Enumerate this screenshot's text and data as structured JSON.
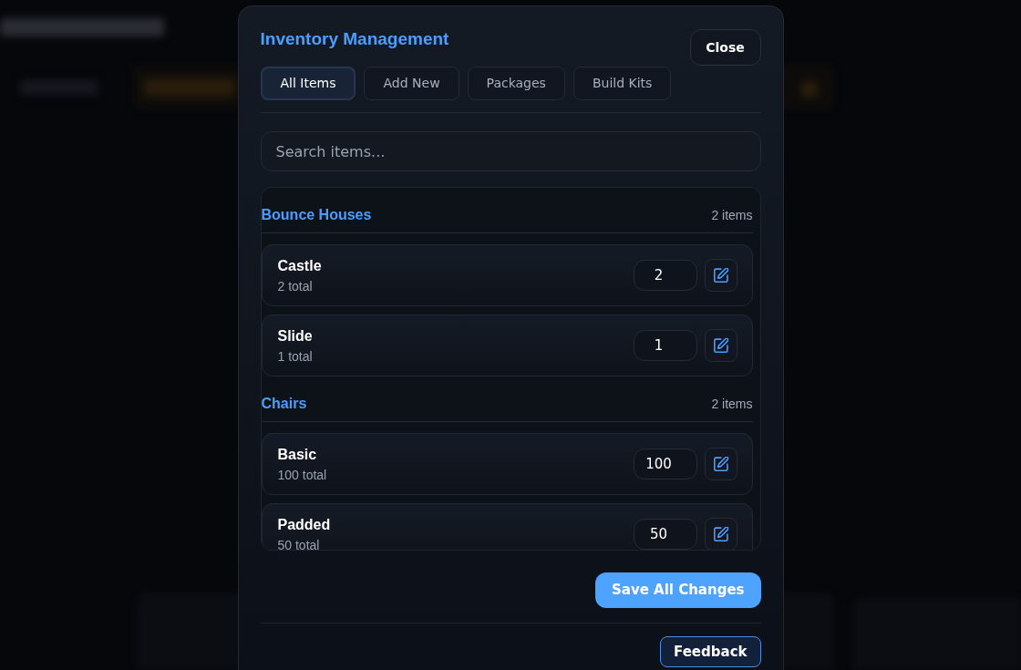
{
  "dialog": {
    "title": "Inventory Management",
    "close_button": "Close",
    "tabs": [
      {
        "label": "All Items",
        "selected": true
      },
      {
        "label": "Add New",
        "selected": false
      },
      {
        "label": "Packages",
        "selected": false
      },
      {
        "label": "Build Kits",
        "selected": false
      }
    ],
    "search": {
      "placeholder": "Search items..."
    },
    "categories": [
      {
        "name": "Bounce Houses",
        "count": "2 items",
        "items": [
          {
            "name": "Castle",
            "total": "2 total",
            "quantity": "2"
          },
          {
            "name": "Slide",
            "total": "1 total",
            "quantity": "1"
          }
        ]
      },
      {
        "name": "Chairs",
        "count": "2 items",
        "items": [
          {
            "name": "Basic",
            "total": "100 total",
            "quantity": "100"
          },
          {
            "name": "Padded",
            "total": "50 total",
            "quantity": "50"
          }
        ]
      }
    ],
    "save_button": "Save All Changes",
    "feedback_button": "Feedback"
  }
}
